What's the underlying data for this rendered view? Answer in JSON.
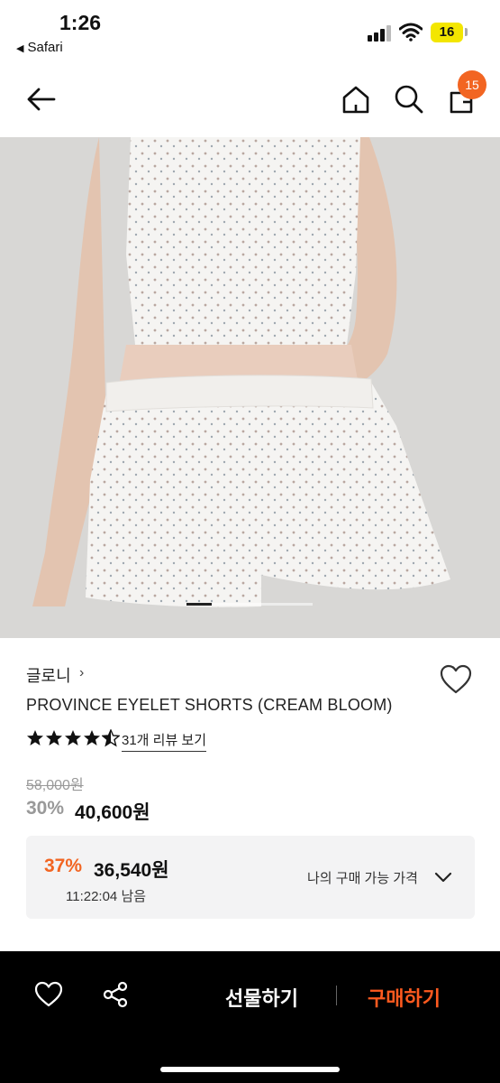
{
  "status": {
    "time": "1:26",
    "back_app": "Safari",
    "battery": "16"
  },
  "nav": {
    "cart_count": "15"
  },
  "product": {
    "brand": "글로니",
    "brand_chevron": "›",
    "name": "PROVINCE EYELET SHORTS (CREAM BLOOM)",
    "rating": 4.5,
    "review_link": "31개 리뷰 보기",
    "original_price": "58,000원",
    "discount_percent": "30%",
    "discount_price": "40,600원"
  },
  "benefit": {
    "percent": "37%",
    "price": "36,540원",
    "time_remaining": "11:22:04 남음",
    "label": "나의 구매 가능 가격"
  },
  "bottom": {
    "gift_label": "선물하기",
    "buy_label": "구매하기"
  },
  "image": {
    "carousel_position": 0.2
  },
  "colors": {
    "accent": "#f26522",
    "buy_text": "#ff5a1f",
    "bottom_bar": "#000000",
    "benefit_bg": "#f3f3f4"
  },
  "icons": [
    "back-arrow-icon",
    "home-icon",
    "search-icon",
    "cart-icon",
    "heart-icon",
    "star-icon",
    "chevron-down-icon",
    "share-icon"
  ]
}
